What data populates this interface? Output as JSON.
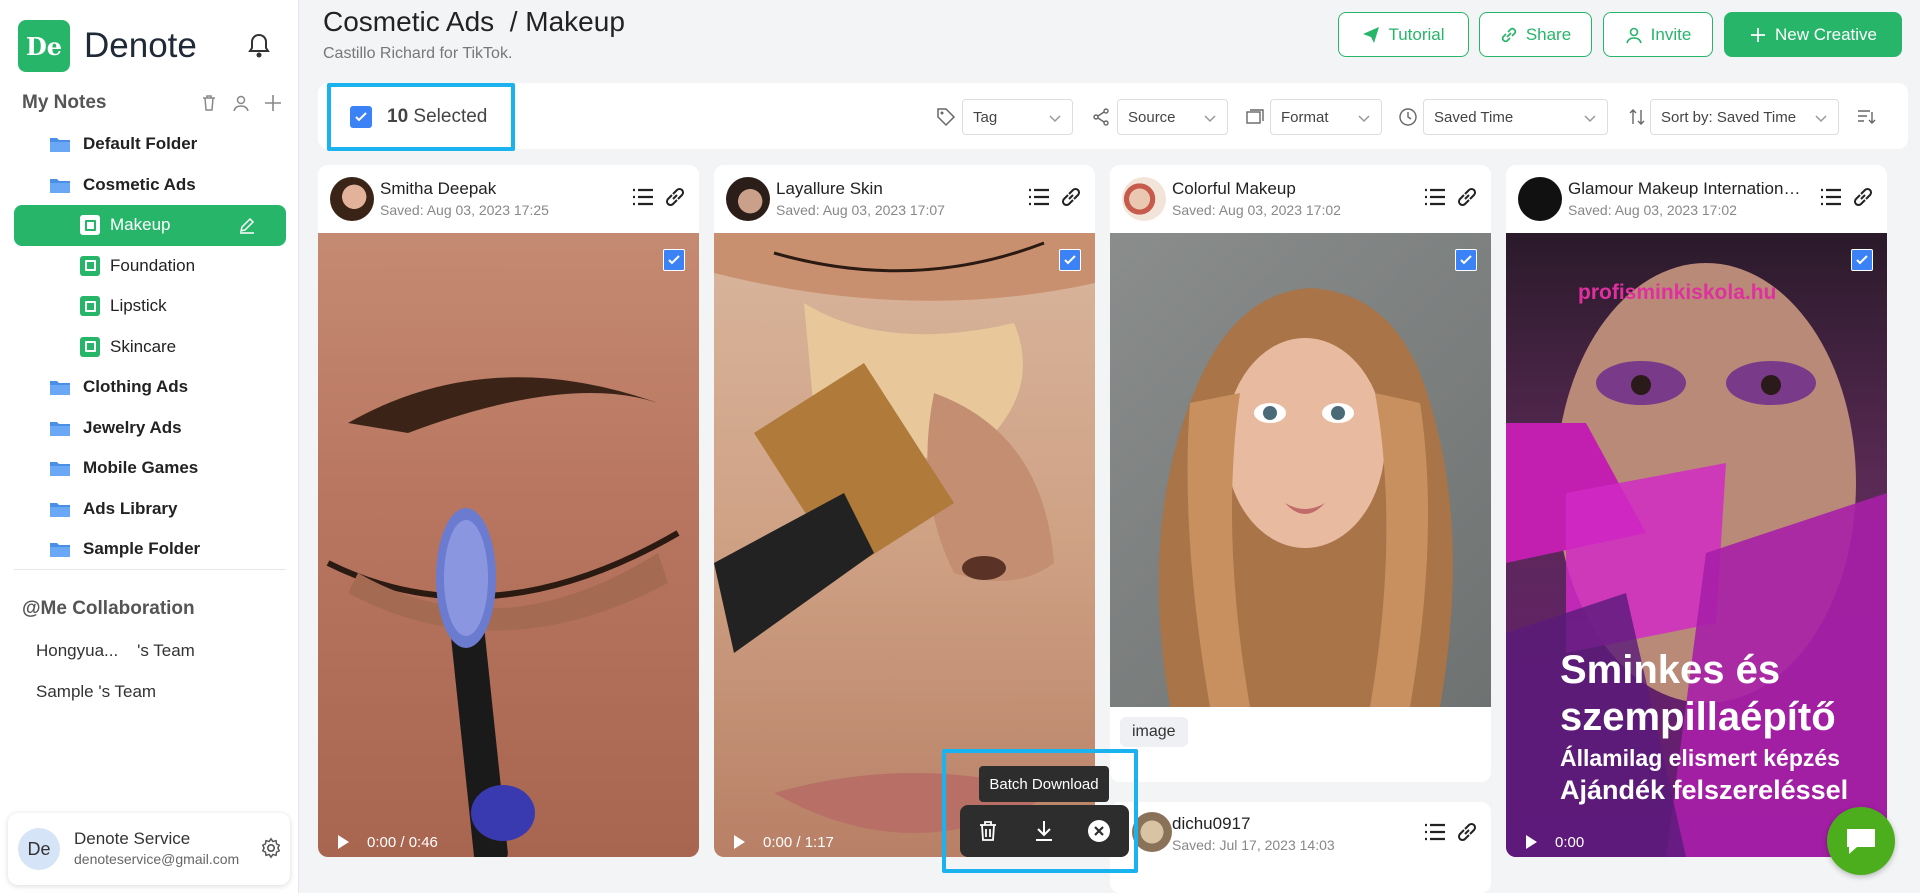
{
  "brand": {
    "logo_text": "De",
    "name": "Denote"
  },
  "sidebar": {
    "section_title": "My Notes",
    "folders": [
      {
        "label": "Default Folder"
      },
      {
        "label": "Cosmetic Ads"
      },
      {
        "label": "Makeup"
      },
      {
        "label": "Foundation"
      },
      {
        "label": "Lipstick"
      },
      {
        "label": "Skincare"
      },
      {
        "label": "Clothing Ads"
      },
      {
        "label": "Jewelry Ads"
      },
      {
        "label": "Mobile Games"
      },
      {
        "label": "Ads Library"
      },
      {
        "label": "Sample Folder"
      }
    ],
    "collab_title": "@Me Collaboration",
    "collab_items": [
      {
        "label": "Hongyua...    's Team"
      },
      {
        "label": "Sample 's Team"
      }
    ],
    "account": {
      "avatar": "De",
      "name": "Denote Service",
      "email": "denoteservice@gmail.com"
    }
  },
  "header": {
    "title": "Cosmetic Ads  / Makeup",
    "subtitle": "Castillo Richard for TikTok.",
    "buttons": {
      "tutorial": "Tutorial",
      "share": "Share",
      "invite": "Invite",
      "new_creative": "New Creative"
    }
  },
  "toolbar": {
    "selected_count": "10",
    "selected_label": " Selected",
    "filters": {
      "tag": "Tag",
      "source": "Source",
      "format": "Format",
      "saved_time": "Saved Time",
      "sort": "Sort by: Saved Time"
    }
  },
  "cards": [
    {
      "name": "Smitha Deepak",
      "saved": "Saved: Aug 03, 2023 17:25",
      "time": "0:00 / 0:46"
    },
    {
      "name": "Layallure Skin",
      "saved": "Saved: Aug 03, 2023 17:07",
      "time": "0:00 / 1:17"
    },
    {
      "name": "Colorful Makeup",
      "saved": "Saved: Aug 03, 2023 17:02",
      "tag": "image"
    },
    {
      "name": "Glamour Makeup International ...",
      "saved": "Saved: Aug 03, 2023 17:02",
      "time": "0:00",
      "ad_url": "profisminkiskola.hu",
      "ad_line1": "Sminkes és",
      "ad_line2": "szempillaépítő",
      "ad_line3": "Államilag elismert képzés",
      "ad_line4": "Ajándék felszereléssel"
    },
    {
      "name": "dichu0917",
      "saved": "Saved: Jul 17, 2023 14:03"
    }
  ],
  "batch": {
    "tooltip": "Batch Download"
  },
  "colors": {
    "accent": "#27b56a",
    "highlight": "#1ab3f0",
    "checkbox": "#3b82f6"
  }
}
